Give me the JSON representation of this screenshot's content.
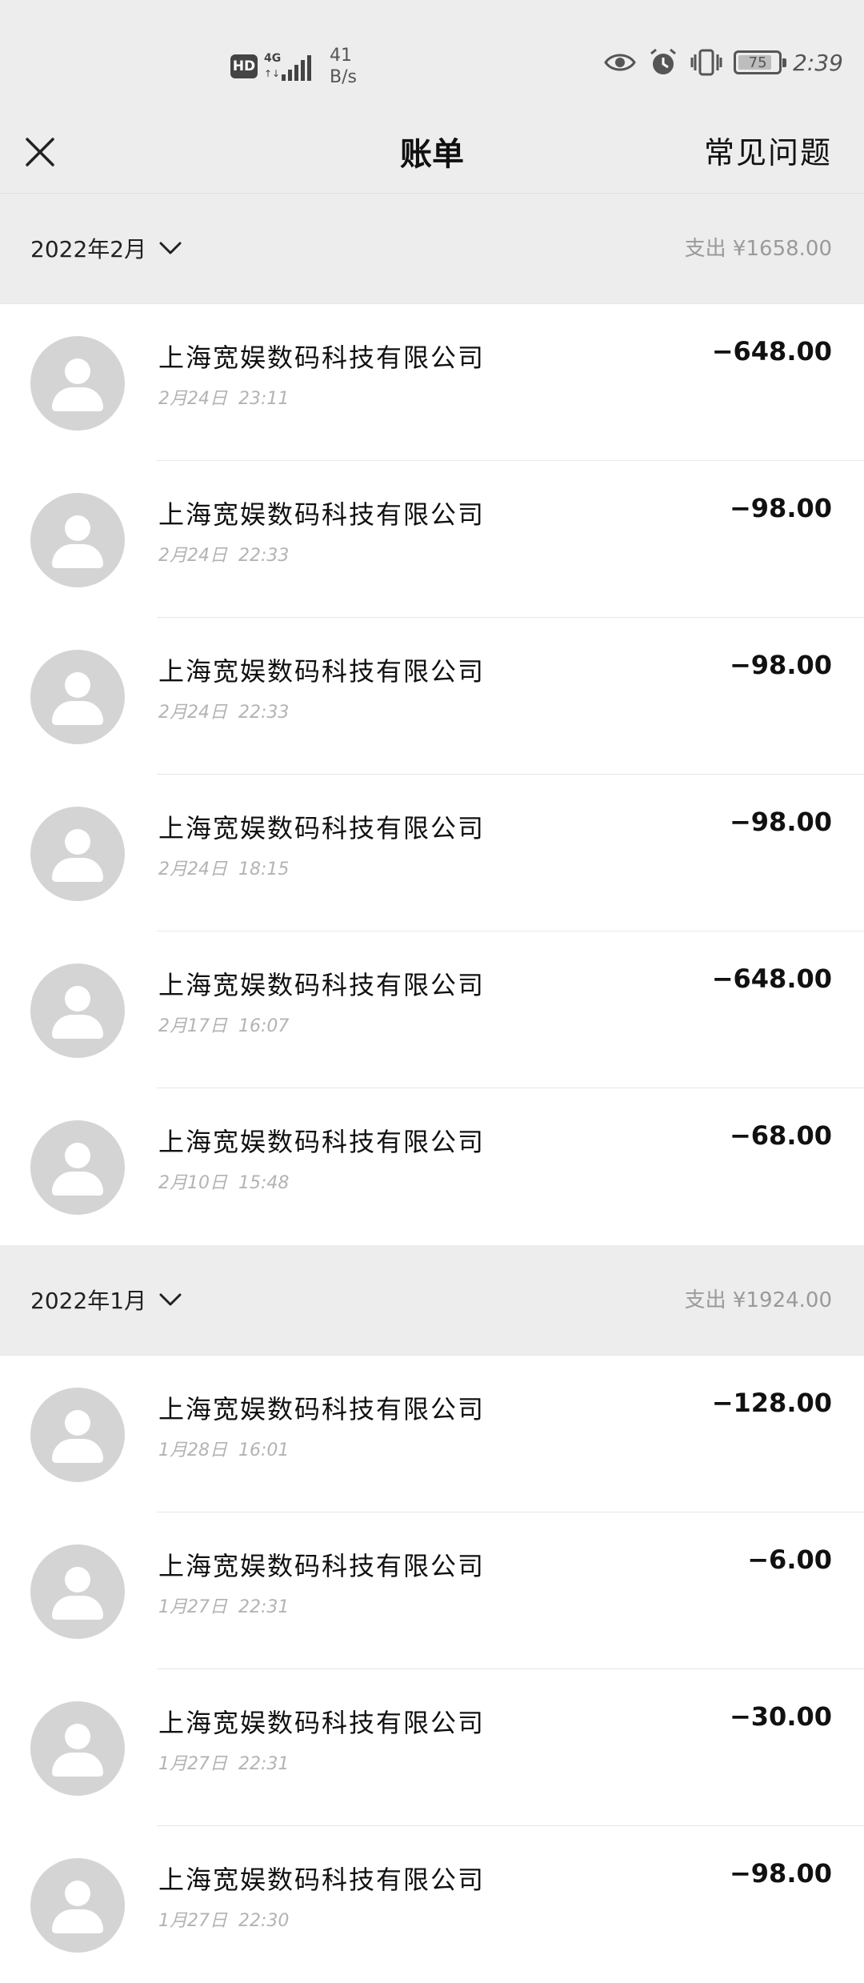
{
  "status_bar": {
    "hd_badge": "HD",
    "network": "4G",
    "net_speed_value": "41",
    "net_speed_unit": "B/s",
    "battery": "75",
    "time": "2:39"
  },
  "nav": {
    "title": "账单",
    "faq": "常见问题",
    "close_icon": "close-icon"
  },
  "months": [
    {
      "label": "2022年2月",
      "total": "支出 ¥1658.00",
      "transactions": [
        {
          "merchant": "上海宽娱数码科技有限公司",
          "date": "2月24日",
          "time": "23:11",
          "amount": "−648.00"
        },
        {
          "merchant": "上海宽娱数码科技有限公司",
          "date": "2月24日",
          "time": "22:33",
          "amount": "−98.00"
        },
        {
          "merchant": "上海宽娱数码科技有限公司",
          "date": "2月24日",
          "time": "22:33",
          "amount": "−98.00"
        },
        {
          "merchant": "上海宽娱数码科技有限公司",
          "date": "2月24日",
          "time": "18:15",
          "amount": "−98.00"
        },
        {
          "merchant": "上海宽娱数码科技有限公司",
          "date": "2月17日",
          "time": "16:07",
          "amount": "−648.00"
        },
        {
          "merchant": "上海宽娱数码科技有限公司",
          "date": "2月10日",
          "time": "15:48",
          "amount": "−68.00"
        }
      ]
    },
    {
      "label": "2022年1月",
      "total": "支出 ¥1924.00",
      "transactions": [
        {
          "merchant": "上海宽娱数码科技有限公司",
          "date": "1月28日",
          "time": "16:01",
          "amount": "−128.00"
        },
        {
          "merchant": "上海宽娱数码科技有限公司",
          "date": "1月27日",
          "time": "22:31",
          "amount": "−6.00"
        },
        {
          "merchant": "上海宽娱数码科技有限公司",
          "date": "1月27日",
          "time": "22:31",
          "amount": "−30.00"
        },
        {
          "merchant": "上海宽娱数码科技有限公司",
          "date": "1月27日",
          "time": "22:30",
          "amount": "−98.00"
        }
      ]
    }
  ]
}
